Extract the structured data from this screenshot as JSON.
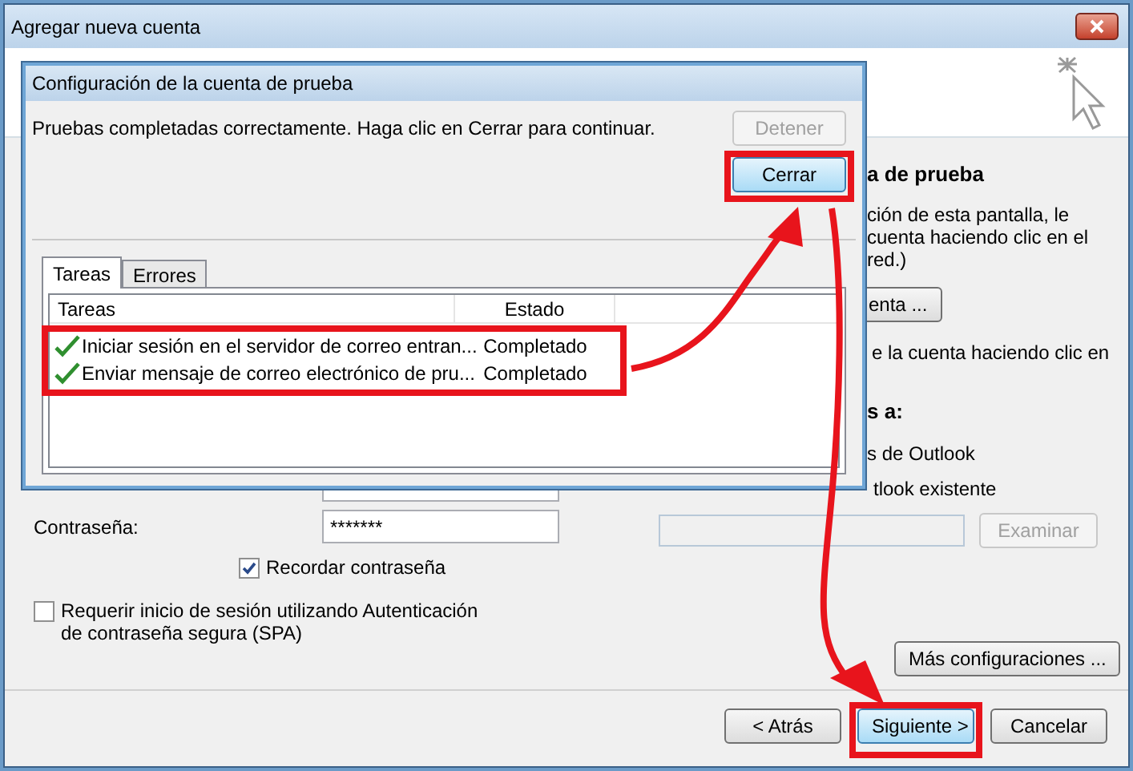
{
  "window": {
    "title": "Agregar nueva cuenta"
  },
  "background": {
    "heading": "a de prueba",
    "lines": [
      "ción de esta pantalla, le",
      "cuenta haciendo clic en el",
      "red.)"
    ],
    "test_button": "enta ...",
    "hint": "e la cuenta haciendo clic en",
    "section": "s a:",
    "options": [
      "s de Outlook",
      "tlook existente"
    ],
    "browse_button": {
      "label": "Examinar",
      "disabled": true
    },
    "password_label": "Contraseña:",
    "password_value": "*******",
    "remember": {
      "label": "Recordar contraseña",
      "checked": true
    },
    "spa": {
      "label": "Requerir inicio de sesión utilizando Autenticación de contraseña segura (SPA)",
      "checked": false
    },
    "more_button": "Más configuraciones ..."
  },
  "dialog": {
    "title": "Configuración de la cuenta de prueba",
    "message": "Pruebas completadas correctamente. Haga clic en Cerrar para continuar.",
    "stop_button": {
      "label": "Detener",
      "disabled": true
    },
    "close_button": "Cerrar",
    "tabs": [
      {
        "label": "Tareas",
        "selected": true
      },
      {
        "label": "Errores",
        "selected": false
      }
    ],
    "columns": [
      "Tareas",
      "Estado"
    ],
    "rows": [
      {
        "task": "Iniciar sesión en el servidor de correo entran...",
        "status": "Completado",
        "done": true
      },
      {
        "task": "Enviar mensaje de correo electrónico de pru...",
        "status": "Completado",
        "done": true
      }
    ]
  },
  "footer": [
    {
      "label": "< Atrás",
      "selected": false
    },
    {
      "label": "Siguiente >",
      "selected": true
    },
    {
      "label": "Cancelar",
      "selected": false
    }
  ]
}
